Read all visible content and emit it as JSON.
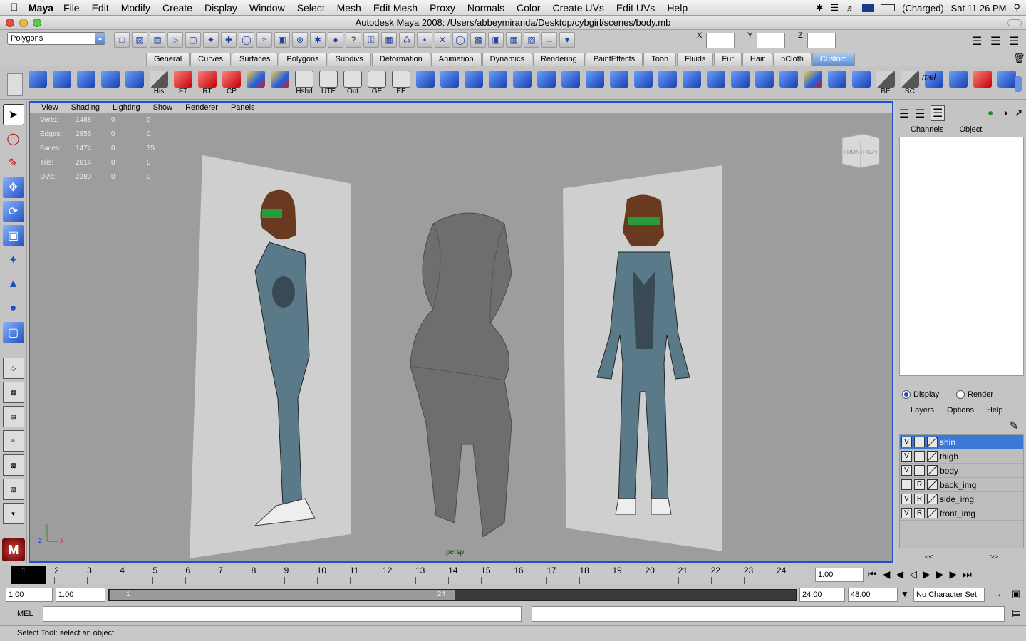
{
  "macmenu": {
    "app": "Maya",
    "items": [
      "File",
      "Edit",
      "Modify",
      "Create",
      "Display",
      "Window",
      "Select",
      "Mesh",
      "Edit Mesh",
      "Proxy",
      "Normals",
      "Color",
      "Create UVs",
      "Edit UVs",
      "Help"
    ],
    "battery": "(Charged)",
    "clock": "Sat 11 26 PM"
  },
  "window": {
    "title": "Autodesk Maya 2008: /Users/abbeymiranda/Desktop/cybgirl/scenes/body.mb"
  },
  "statusline": {
    "mode": "Polygons",
    "x_label": "X",
    "y_label": "Y",
    "z_label": "Z"
  },
  "shelf": {
    "tabs": [
      "General",
      "Curves",
      "Surfaces",
      "Polygons",
      "Subdivs",
      "Deformation",
      "Animation",
      "Dynamics",
      "Rendering",
      "PaintEffects",
      "Toon",
      "Fluids",
      "Fur",
      "Hair",
      "nCloth",
      "Custom"
    ],
    "active_tab": "Custom",
    "icon_labels": [
      "",
      "",
      "",
      "",
      "",
      "His",
      "FT",
      "RT",
      "CP",
      "",
      "",
      "Hshd",
      "UTE",
      "Out",
      "GE",
      "EE"
    ],
    "tail_labels": [
      "BE",
      "BC"
    ],
    "mel_label": "mel"
  },
  "panel": {
    "menus": [
      "View",
      "Shading",
      "Lighting",
      "Show",
      "Renderer",
      "Panels"
    ],
    "camera": "persp",
    "viewcube": {
      "front": "FRONT",
      "right": "RIGHT"
    },
    "axis": {
      "y": "y",
      "z": "z",
      "x": "x"
    }
  },
  "hud": [
    {
      "label": "Verts:",
      "a": "1488",
      "b": "0",
      "c": "0"
    },
    {
      "label": "Edges:",
      "a": "2956",
      "b": "0",
      "c": "0"
    },
    {
      "label": "Faces:",
      "a": "1474",
      "b": "0",
      "c": "35"
    },
    {
      "label": "Tris:",
      "a": "2814",
      "b": "0",
      "c": "0"
    },
    {
      "label": "UVs:",
      "a": "2280",
      "b": "0",
      "c": "0"
    }
  ],
  "channelbox": {
    "tabs": [
      "Channels",
      "Object"
    ],
    "display_radio": "Display",
    "render_radio": "Render",
    "layer_menus": [
      "Layers",
      "Options",
      "Help"
    ],
    "layers": [
      {
        "v": "V",
        "r": "",
        "name": "shin",
        "selected": true
      },
      {
        "v": "V",
        "r": "",
        "name": "thigh",
        "selected": false
      },
      {
        "v": "V",
        "r": "",
        "name": "body",
        "selected": false
      },
      {
        "v": "",
        "r": "R",
        "name": "back_img",
        "selected": false
      },
      {
        "v": "V",
        "r": "R",
        "name": "side_img",
        "selected": false
      },
      {
        "v": "V",
        "r": "R",
        "name": "front_img",
        "selected": false
      }
    ],
    "scroll_left": "<<",
    "scroll_right": ">>"
  },
  "timeslider": {
    "current_frame": "1",
    "frames": [
      "2",
      "3",
      "4",
      "5",
      "6",
      "7",
      "8",
      "9",
      "10",
      "11",
      "12",
      "13",
      "14",
      "15",
      "16",
      "17",
      "18",
      "19",
      "20",
      "21",
      "22",
      "23",
      "24"
    ],
    "current_time": "1.00"
  },
  "rangeslider": {
    "start": "1.00",
    "playback_start": "1.00",
    "range_start_label": "1",
    "range_end_label": "24",
    "playback_end": "24.00",
    "end": "48.00",
    "character_set": "No Character Set"
  },
  "cmdline": {
    "label": "MEL"
  },
  "helpline": {
    "text": "Select Tool: select an object"
  }
}
